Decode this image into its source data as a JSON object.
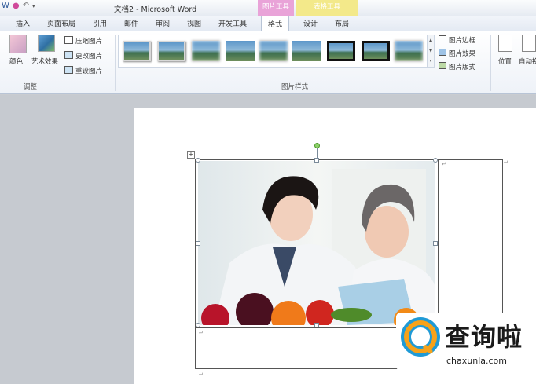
{
  "title_bar": {
    "qat_icons": [
      "word-icon",
      "undo-icon",
      "color-icon",
      "dropdown-icon"
    ],
    "window_title": "文档2 - Microsoft Word",
    "context_picture_tools": "图片工具",
    "context_table_tools": "表格工具"
  },
  "tabs": [
    {
      "label": "插入"
    },
    {
      "label": "页面布局"
    },
    {
      "label": "引用"
    },
    {
      "label": "邮件"
    },
    {
      "label": "审阅"
    },
    {
      "label": "视图"
    },
    {
      "label": "开发工具"
    },
    {
      "label": "格式",
      "active": true
    },
    {
      "label": "设计"
    },
    {
      "label": "布局"
    }
  ],
  "ribbon": {
    "adjust_group": {
      "label": "调整",
      "color": "颜色",
      "art_effects": "艺术效果",
      "compress": "压缩图片",
      "change": "更改图片",
      "reset": "重设图片"
    },
    "styles_group": {
      "label": "图片样式",
      "border": "图片边框",
      "effects": "图片效果",
      "layout": "图片版式",
      "thumb_count": 9
    },
    "arrange_group": {
      "position": "位置",
      "wrap": "自动换"
    }
  },
  "watermark": {
    "text": "查询啦",
    "url": "chaxunla.com"
  }
}
